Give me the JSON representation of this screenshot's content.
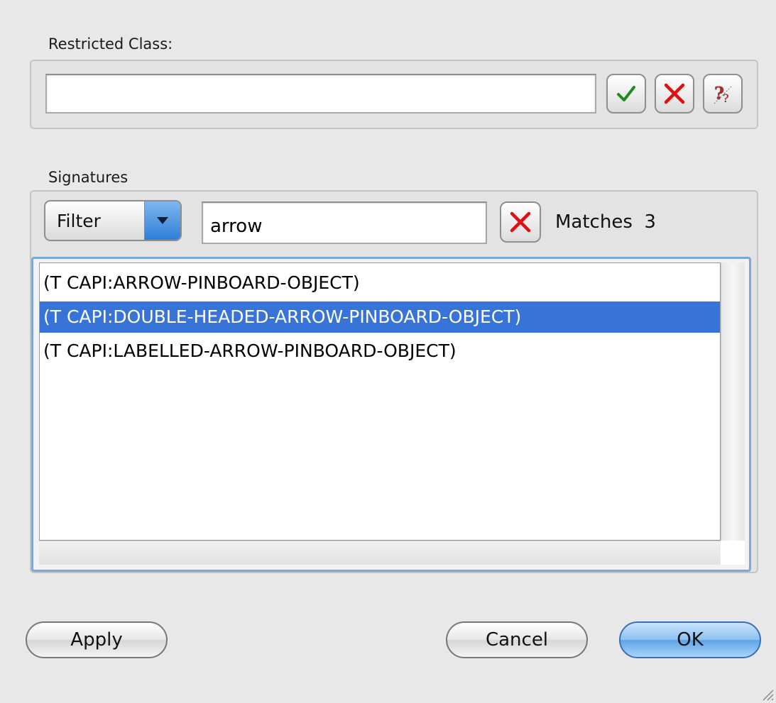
{
  "restricted_class": {
    "label": "Restricted Class:",
    "value": "",
    "buttons": {
      "confirm_icon": "checkmark-icon",
      "cancel_icon": "red-x-icon",
      "help_icon": "question-icon"
    }
  },
  "signatures": {
    "label": "Signatures",
    "filter_label": "Filter",
    "filter_value": "arrow",
    "clear_icon": "red-x-icon",
    "matches_label": "Matches",
    "matches_count": "3",
    "items": [
      {
        "text": "(T CAPI:ARROW-PINBOARD-OBJECT)",
        "selected": false
      },
      {
        "text": "(T CAPI:DOUBLE-HEADED-ARROW-PINBOARD-OBJECT)",
        "selected": true
      },
      {
        "text": "(T CAPI:LABELLED-ARROW-PINBOARD-OBJECT)",
        "selected": false
      }
    ]
  },
  "buttons": {
    "apply": "Apply",
    "cancel": "Cancel",
    "ok": "OK"
  },
  "colors": {
    "selection": "#3874d8",
    "check_green": "#1f8a1f",
    "x_red": "#e01010",
    "default_button": "#5da3e6"
  }
}
